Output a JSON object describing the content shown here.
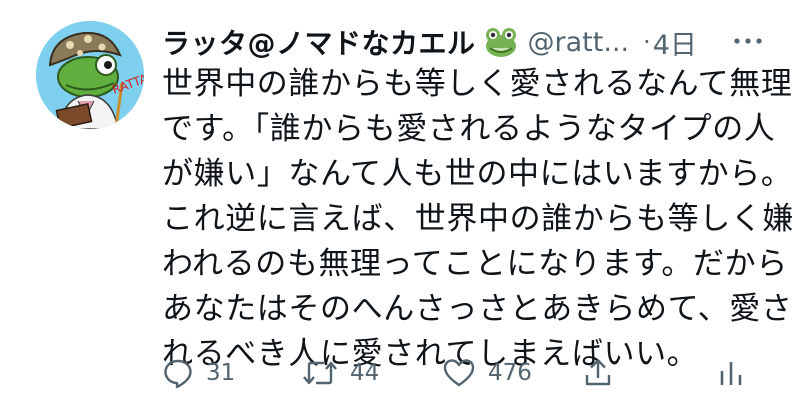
{
  "tweet": {
    "display_name": "ラッタ@ノマドなカエル",
    "emoji": "frog-emoji",
    "handle": "@ratt...",
    "separator": "·",
    "time": "4日",
    "lines": [
      "世界中の誰からも等しく愛されるなんて無理",
      "です。「誰からも愛されるようなタイプの人",
      "が嫌い」なんて人も世の中にはいますから。",
      "これ逆に言えば、世界中の誰からも等しく嫌",
      "われるのも無理ってことになります。だから",
      "あなたはそのへんさっさとあきらめて、愛さ",
      "れるべき人に愛されてしまえばいい。"
    ]
  },
  "avatar_text": "RATTA",
  "actions": {
    "reply_count": "31",
    "retweet_count": "44",
    "like_count": "476"
  },
  "colors": {
    "text": "#0f1419",
    "secondary": "#536471",
    "avatar_bg": "#7fd0ee"
  }
}
